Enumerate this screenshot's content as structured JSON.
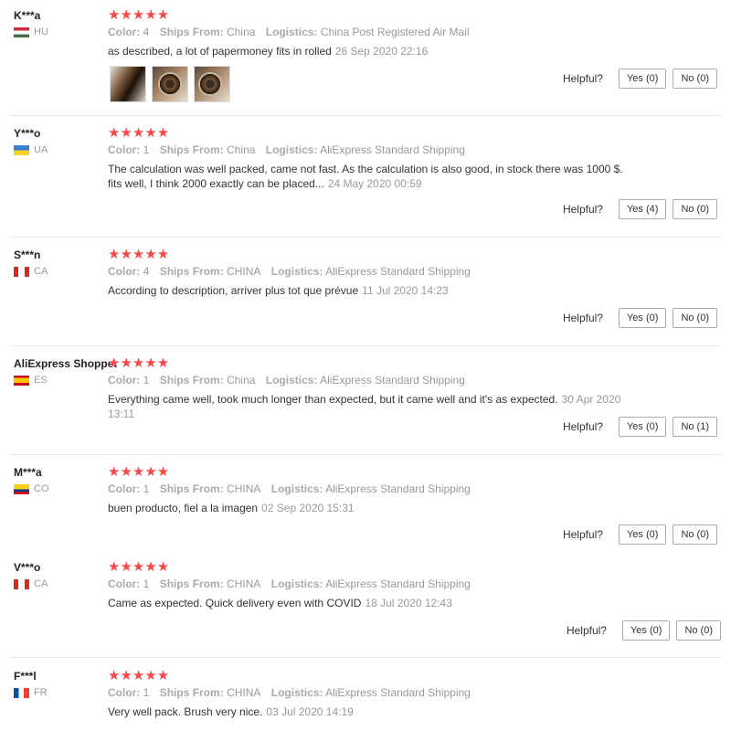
{
  "labels": {
    "color": "Color:",
    "ships_from": "Ships From:",
    "logistics": "Logistics:",
    "helpful": "Helpful?"
  },
  "reviews": [
    {
      "user": "K***a",
      "country": "HU",
      "flag": "hu",
      "stars": "★★★★★",
      "color": "4",
      "ships_from": "China",
      "logistics": "China Post Registered Air Mail",
      "text": "as described, a lot of papermoney fits in rolled",
      "date": "26 Sep 2020 22:16",
      "yes": "Yes (0)",
      "no": "No (0)"
    },
    {
      "user": "Y***o",
      "country": "UA",
      "flag": "ua",
      "stars": "★★★★★",
      "color": "1",
      "ships_from": "China",
      "logistics": "AliExpress Standard Shipping",
      "text": "The calculation was well packed, came not fast. As the calculation is also good, in stock there was 1000 $. fits well, I think 2000 exactly can be placed...",
      "date": "24 May 2020 00:59",
      "yes": "Yes (4)",
      "no": "No (0)"
    },
    {
      "user": "S***n",
      "country": "CA",
      "flag": "ca",
      "stars": "★★★★★",
      "color": "4",
      "ships_from": "CHINA",
      "logistics": "AliExpress Standard Shipping",
      "text": "According to description, arriver plus tot que prévue",
      "date": "11 Jul 2020 14:23",
      "yes": "Yes (0)",
      "no": "No (0)"
    },
    {
      "user": "AliExpress Shopper",
      "country": "ES",
      "flag": "es",
      "stars": "★★★★★",
      "color": "1",
      "ships_from": "China",
      "logistics": "AliExpress Standard Shipping",
      "text": "Everything came well, took much longer than expected, but it came well and it's as expected.",
      "date": "30 Apr 2020 13:11",
      "yes": "Yes (0)",
      "no": "No (1)"
    },
    {
      "user": "M***a",
      "country": "CO",
      "flag": "co",
      "stars": "★★★★★",
      "color": "1",
      "ships_from": "CHINA",
      "logistics": "AliExpress Standard Shipping",
      "text": "buen producto, fiel a la imagen",
      "date": "02 Sep 2020 15:31",
      "yes": "Yes (0)",
      "no": "No (0)"
    },
    {
      "user": "V***o",
      "country": "CA",
      "flag": "ca",
      "stars": "★★★★★",
      "color": "1",
      "ships_from": "CHINA",
      "logistics": "AliExpress Standard Shipping",
      "text": "Came as expected. Quick delivery even with COVID",
      "date": "18 Jul 2020 12:43",
      "yes": "Yes (0)",
      "no": "No (0)"
    },
    {
      "user": "F***l",
      "country": "FR",
      "flag": "fr",
      "stars": "★★★★★",
      "color": "1",
      "ships_from": "CHINA",
      "logistics": "AliExpress Standard Shipping",
      "text": "Very well pack. Brush very nice.",
      "date": "03 Jul 2020 14:19",
      "yes": "Yes (0)",
      "no": "No (0)"
    }
  ],
  "photos": [
    "photo-1",
    "photo-2",
    "photo-3"
  ]
}
